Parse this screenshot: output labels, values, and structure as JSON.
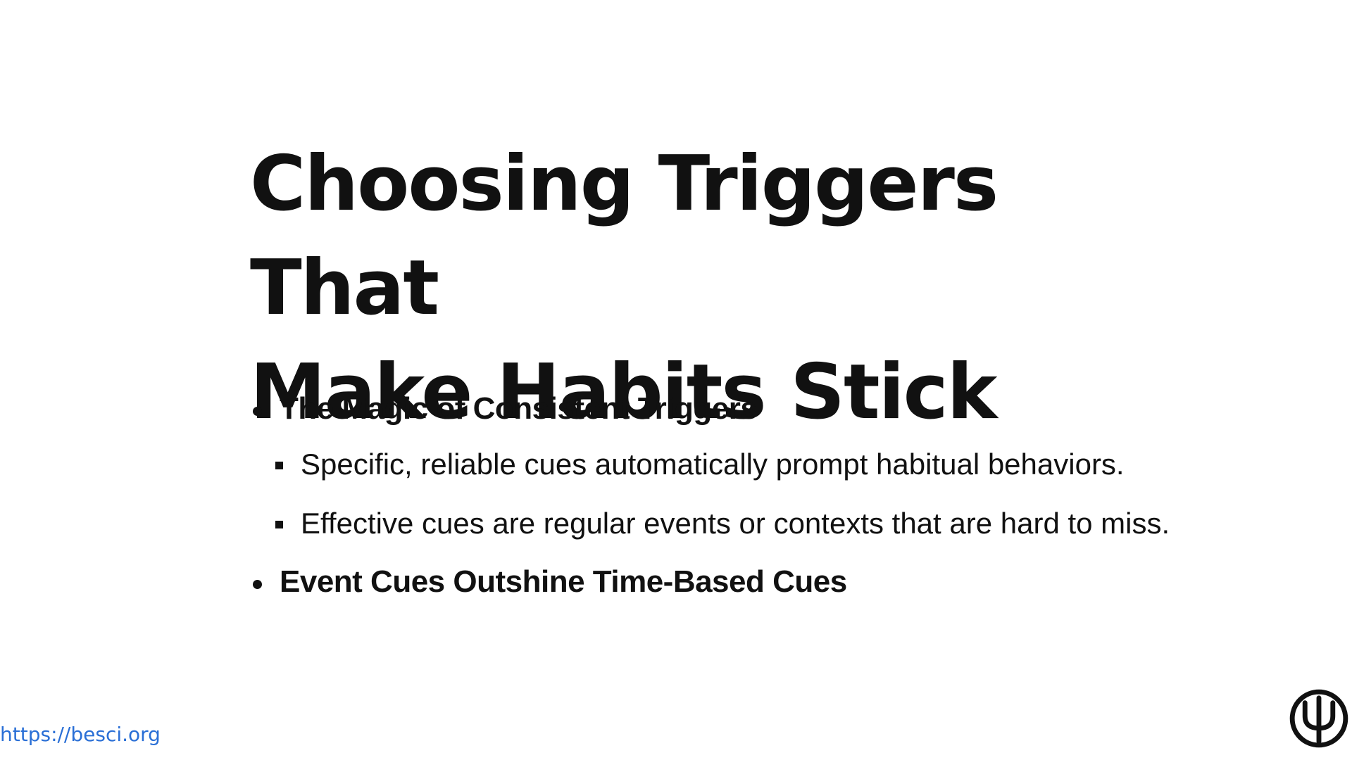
{
  "slide": {
    "title_line1": "Choosing Triggers That",
    "title_line2": "Make Habits Stick",
    "sections": [
      {
        "heading": "The Magic of Consistent Triggers",
        "points": [
          "Specific, reliable cues automatically prompt habitual behaviors.",
          "Effective cues are regular events or contexts that are hard to miss."
        ]
      },
      {
        "heading": "Event Cues Outshine Time-Based Cues"
      }
    ]
  },
  "footer": {
    "url": "https://besci.org"
  },
  "icons": {
    "logo": "psi-logo-icon"
  },
  "colors": {
    "text": "#111111",
    "link": "#2a6fd6",
    "background": "#ffffff"
  }
}
